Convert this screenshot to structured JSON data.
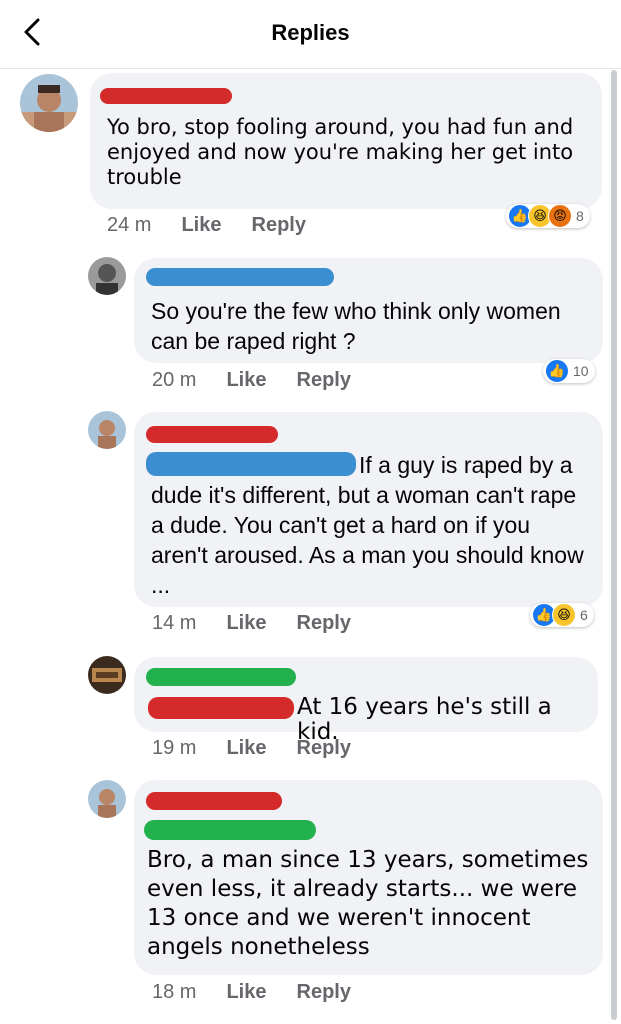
{
  "header": {
    "title": "Replies"
  },
  "comments": [
    {
      "text": "Yo bro, stop fooling around, you had fun and enjoyed and now you're making her get into trouble",
      "time": "24 m",
      "like": "Like",
      "reply": "Reply",
      "reaction_count": "8",
      "reactions": [
        "like-icon",
        "haha-icon",
        "angry-icon"
      ]
    },
    {
      "text": "So you're the few who think only women can be raped right ?",
      "time": "20 m",
      "like": "Like",
      "reply": "Reply",
      "reaction_count": "10",
      "reactions": [
        "like-icon"
      ]
    },
    {
      "text_line1": "If a guy is raped by a",
      "text_rest": "dude it's different, but a woman can't rape a dude. You can't get a hard on if you aren't aroused. As a man you should know ...",
      "time": "14 m",
      "like": "Like",
      "reply": "Reply",
      "reaction_count": "6",
      "reactions": [
        "like-icon",
        "haha-icon"
      ]
    },
    {
      "text": "At 16 years he's still a kid.",
      "time": "19 m",
      "like": "Like",
      "reply": "Reply"
    },
    {
      "text": "Bro, a man since 13 years, sometimes even less, it already starts... we were 13 once and we weren't innocent angels nonetheless",
      "time": "18 m",
      "like": "Like",
      "reply": "Reply"
    }
  ],
  "colors": {
    "redact_red": "#d42a2a",
    "redact_blue": "#3b8fd1",
    "redact_green": "#22b14c",
    "like_blue": "#1877f2",
    "bubble_gray": "#f0f2f5",
    "meta_gray": "#65676b"
  }
}
